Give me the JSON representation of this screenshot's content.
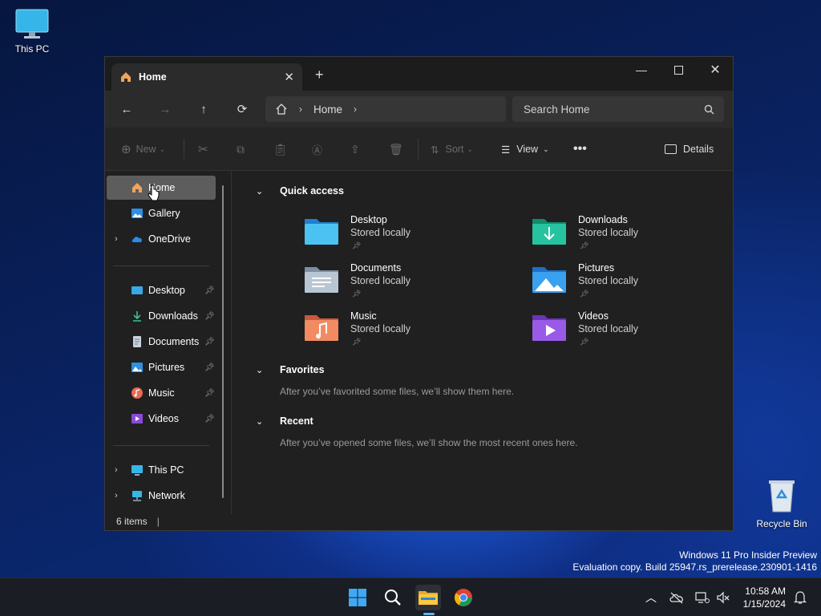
{
  "desktop": {
    "this_pc_label": "This PC",
    "recycle_bin_label": "Recycle Bin",
    "watermark_line1": "Windows 11 Pro Insider Preview",
    "watermark_line2": "Evaluation copy. Build 25947.rs_prerelease.230901-1416"
  },
  "window": {
    "tab_title": "Home",
    "address_segment": "Home",
    "search_placeholder": "Search Home",
    "toolbar": {
      "new_label": "New",
      "sort_label": "Sort",
      "view_label": "View",
      "details_label": "Details"
    },
    "sidebar": {
      "top": [
        {
          "label": "Home"
        },
        {
          "label": "Gallery"
        },
        {
          "label": "OneDrive"
        }
      ],
      "pinned": [
        {
          "label": "Desktop"
        },
        {
          "label": "Downloads"
        },
        {
          "label": "Documents"
        },
        {
          "label": "Pictures"
        },
        {
          "label": "Music"
        },
        {
          "label": "Videos"
        }
      ],
      "bottom": [
        {
          "label": "This PC"
        },
        {
          "label": "Network"
        }
      ]
    },
    "sections": {
      "quick_access": "Quick access",
      "favorites": "Favorites",
      "favorites_hint": "After you’ve favorited some files, we’ll show them here.",
      "recent": "Recent",
      "recent_hint": "After you’ve opened some files, we’ll show the most recent ones here."
    },
    "quick_access_items": [
      {
        "name": "Desktop",
        "status": "Stored locally"
      },
      {
        "name": "Downloads",
        "status": "Stored locally"
      },
      {
        "name": "Documents",
        "status": "Stored locally"
      },
      {
        "name": "Pictures",
        "status": "Stored locally"
      },
      {
        "name": "Music",
        "status": "Stored locally"
      },
      {
        "name": "Videos",
        "status": "Stored locally"
      }
    ],
    "status_bar": "6 items"
  },
  "taskbar": {
    "time": "10:58 AM",
    "date": "1/15/2024"
  },
  "colors": {
    "accent": "#0078d4",
    "window_bg": "#202020",
    "selection": "#5d5d5d"
  }
}
